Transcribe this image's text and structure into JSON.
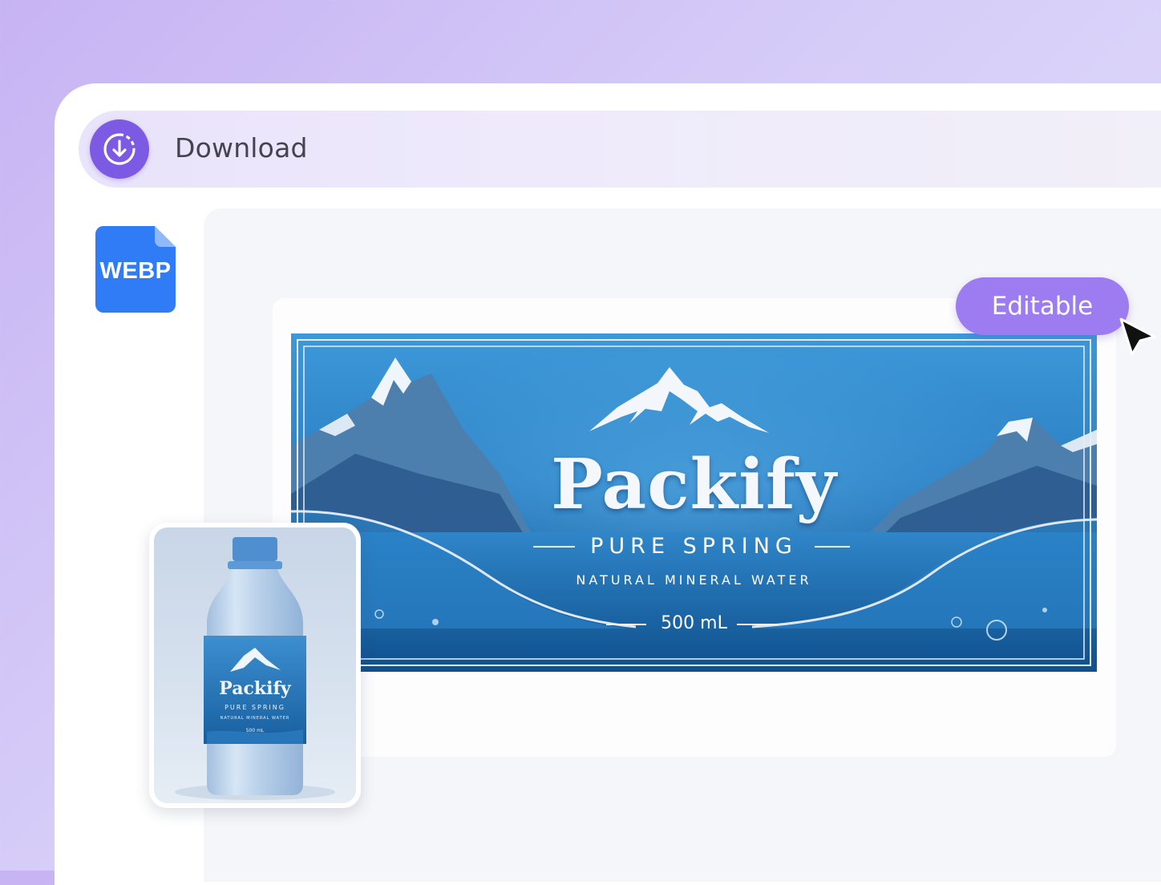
{
  "toolbar": {
    "download_label": "Download",
    "download_icon": "download-circle-icon"
  },
  "file": {
    "format": "WEBP",
    "icon": "file-icon",
    "color": "#2f7cf6"
  },
  "badge": {
    "label": "Editable",
    "color": "#9d7bf0"
  },
  "label_design": {
    "brand": "Packify",
    "tagline": "PURE SPRING",
    "subline": "NATURAL MINERAL WATER",
    "volume": "500 mL"
  },
  "mockup": {
    "brand": "Packify",
    "tagline": "PURE SPRING",
    "subline": "NATURAL MINERAL WATER",
    "volume": "500 mL"
  },
  "colors": {
    "accent": "#7d5ae4",
    "label_blue": "#1b6fb4"
  }
}
